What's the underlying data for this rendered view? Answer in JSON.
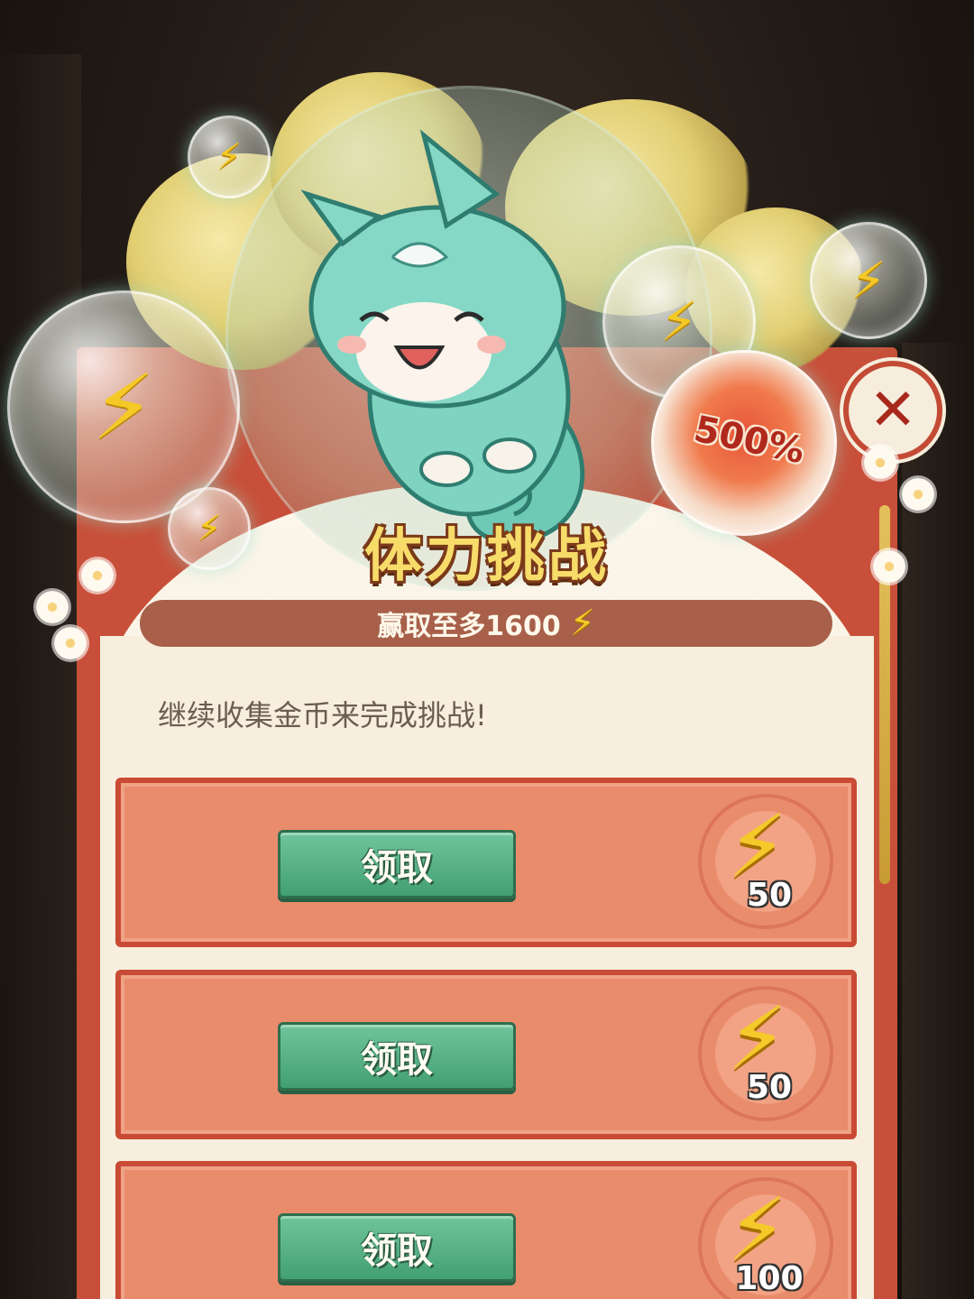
{
  "popup": {
    "title": "体力挑战",
    "win_label": "赢取至多1600",
    "subtitle": "继续收集金币来完成挑战!",
    "bonus_bubble": "500%",
    "close_symbol": "✕",
    "bolt_symbol": "⚡"
  },
  "rewards": [
    {
      "button_label": "领取",
      "amount": "50"
    },
    {
      "button_label": "领取",
      "amount": "50"
    },
    {
      "button_label": "领取",
      "amount": "100"
    }
  ],
  "colors": {
    "panel_red": "#c8503a",
    "row_salmon": "#e98c6c",
    "button_green": "#43a072",
    "title_gold": "#f7dc6a",
    "bolt_yellow": "#f5c92a"
  }
}
